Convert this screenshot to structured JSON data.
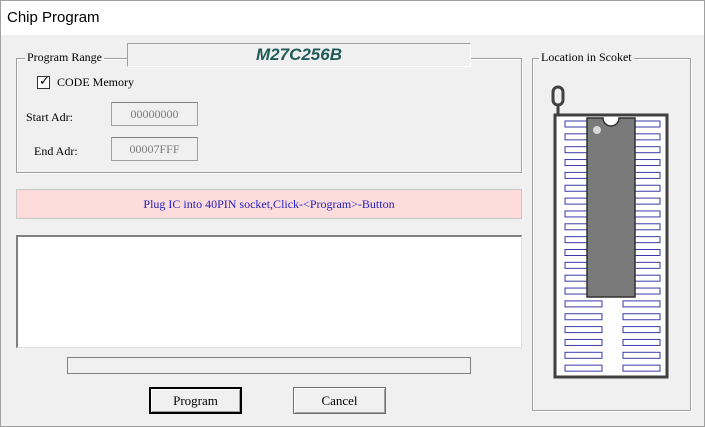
{
  "window": {
    "title": "Chip Program"
  },
  "program_range": {
    "legend": "Program Range",
    "chip_name": "M27C256B",
    "code_memory": {
      "label": "CODE Memory",
      "checked": true
    },
    "start_label": "Start Adr:",
    "start_value": "00000000",
    "end_label": "End Adr:",
    "end_value": "00007FFF"
  },
  "location": {
    "legend": "Location in Scoket",
    "socket_pins": 40,
    "chip_pins": 28
  },
  "message": "Plug IC into 40PIN socket,Click-<Program>-Button",
  "log_text": "",
  "progress": {
    "fraction": 0
  },
  "buttons": {
    "program": "Program",
    "cancel": "Cancel"
  }
}
